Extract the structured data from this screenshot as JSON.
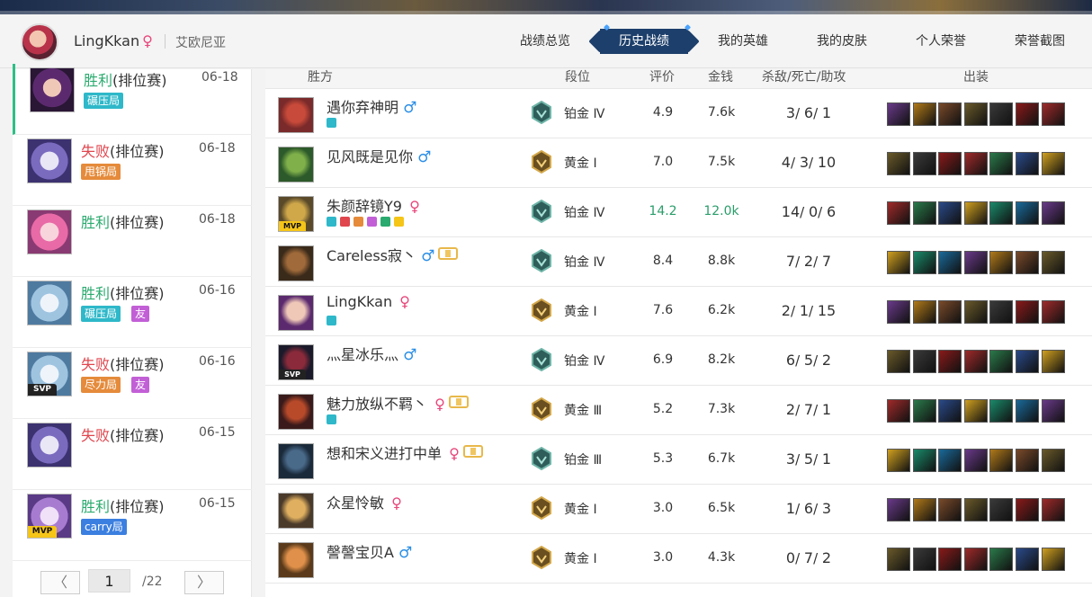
{
  "header": {
    "username": "LingKkan",
    "gender": "♀",
    "server": "艾欧尼亚",
    "nav": [
      {
        "label": "战绩总览",
        "active": false
      },
      {
        "label": "历史战绩",
        "active": true
      },
      {
        "label": "我的英雄",
        "active": false
      },
      {
        "label": "我的皮肤",
        "active": false
      },
      {
        "label": "个人荣誉",
        "active": false
      },
      {
        "label": "荣誉截图",
        "active": false
      }
    ]
  },
  "matches": [
    {
      "result": "胜利",
      "queue": "(排位赛)",
      "date": "06-18",
      "tags": [
        "碾压局"
      ],
      "badge": "",
      "selected": true,
      "status": "win"
    },
    {
      "result": "失败",
      "queue": "(排位赛)",
      "date": "06-18",
      "tags": [
        "甩锅局"
      ],
      "badge": "",
      "selected": false,
      "status": "lose"
    },
    {
      "result": "胜利",
      "queue": "(排位赛)",
      "date": "06-18",
      "tags": [],
      "badge": "",
      "selected": false,
      "status": "win"
    },
    {
      "result": "胜利",
      "queue": "(排位赛)",
      "date": "06-16",
      "tags": [
        "碾压局",
        "友"
      ],
      "badge": "",
      "selected": false,
      "status": "win"
    },
    {
      "result": "失败",
      "queue": "(排位赛)",
      "date": "06-16",
      "tags": [
        "尽力局",
        "友"
      ],
      "badge": "SVP",
      "selected": false,
      "status": "lose"
    },
    {
      "result": "失败",
      "queue": "(排位赛)",
      "date": "06-15",
      "tags": [],
      "badge": "",
      "selected": false,
      "status": "lose"
    },
    {
      "result": "胜利",
      "queue": "(排位赛)",
      "date": "06-15",
      "tags": [
        "carry局"
      ],
      "badge": "MVP",
      "selected": false,
      "status": "win"
    }
  ],
  "pager": {
    "prev": "〈",
    "page": "1",
    "total": "/22",
    "next": "〉"
  },
  "table": {
    "headers": {
      "team": "胜方",
      "rank": "段位",
      "score": "评价",
      "gold": "金钱",
      "kda": "杀敌/死亡/助攻",
      "items": "出装"
    },
    "rows": [
      {
        "name": "遇你弃神明",
        "gender": "♂",
        "rank": "铂金 Ⅳ",
        "tier": "platinum",
        "score": "4.9",
        "gold": "7.6k",
        "k": "3",
        "d": "6",
        "a": "1",
        "badge": "",
        "honor": false,
        "highlight": false
      },
      {
        "name": "见风既是见你",
        "gender": "♂",
        "rank": "黄金 Ⅰ",
        "tier": "gold",
        "score": "7.0",
        "gold": "7.5k",
        "k": "4",
        "d": "3",
        "a": "10",
        "badge": "",
        "honor": false,
        "highlight": false
      },
      {
        "name": "朱颜辞镜Y9",
        "gender": "♀",
        "rank": "铂金 Ⅳ",
        "tier": "platinum",
        "score": "14.2",
        "gold": "12.0k",
        "k": "14",
        "d": "0",
        "a": "6",
        "badge": "MVP",
        "honor": false,
        "highlight": true
      },
      {
        "name": "Careless寂丶",
        "gender": "♂",
        "rank": "铂金 Ⅳ",
        "tier": "platinum",
        "score": "8.4",
        "gold": "8.8k",
        "k": "7",
        "d": "2",
        "a": "7",
        "badge": "",
        "honor": true,
        "highlight": false
      },
      {
        "name": "LingKkan",
        "gender": "♀",
        "rank": "黄金 Ⅰ",
        "tier": "gold",
        "score": "7.6",
        "gold": "6.2k",
        "k": "2",
        "d": "1",
        "a": "15",
        "badge": "",
        "honor": false,
        "highlight": false
      },
      {
        "name": "灬星冰乐灬",
        "gender": "♂",
        "rank": "铂金 Ⅳ",
        "tier": "platinum",
        "score": "6.9",
        "gold": "8.2k",
        "k": "6",
        "d": "5",
        "a": "2",
        "badge": "SVP",
        "honor": false,
        "highlight": false
      },
      {
        "name": "魅力放纵不羁丶",
        "gender": "♀",
        "rank": "黄金 Ⅲ",
        "tier": "gold",
        "score": "5.2",
        "gold": "7.3k",
        "k": "2",
        "d": "7",
        "a": "1",
        "badge": "",
        "honor": true,
        "highlight": false
      },
      {
        "name": "想和宋义进打中单",
        "gender": "♀",
        "rank": "铂金 Ⅲ",
        "tier": "platinum",
        "score": "5.3",
        "gold": "6.7k",
        "k": "3",
        "d": "5",
        "a": "1",
        "badge": "",
        "honor": true,
        "highlight": false
      },
      {
        "name": "众星怜敏",
        "gender": "♀",
        "rank": "黄金 Ⅰ",
        "tier": "gold",
        "score": "3.0",
        "gold": "6.5k",
        "k": "1",
        "d": "6",
        "a": "3",
        "badge": "",
        "honor": false,
        "highlight": false
      },
      {
        "name": "謦謦宝贝A",
        "gender": "♂",
        "rank": "黄金 Ⅰ",
        "tier": "gold",
        "score": "3.0",
        "gold": "4.3k",
        "k": "0",
        "d": "7",
        "a": "2",
        "badge": "",
        "honor": false,
        "highlight": false
      }
    ]
  },
  "colors": {
    "win": "#2aaa6e",
    "lose": "#e0464e",
    "nav_active": "#1d3f6b",
    "highlight": "#2a9d6a",
    "male": "#2a8ee6",
    "female": "#e8457a"
  }
}
